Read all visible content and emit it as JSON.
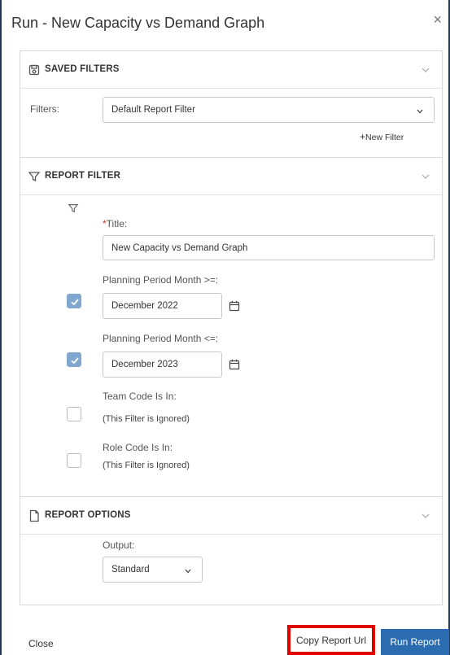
{
  "modal": {
    "title": "Run - New Capacity vs Demand Graph",
    "close_glyph": "×"
  },
  "saved_filters": {
    "heading": "SAVED FILTERS",
    "filters_label": "Filters:",
    "selected_filter": "Default Report Filter",
    "new_filter_label": "New Filter"
  },
  "report_filter": {
    "heading": "REPORT FILTER",
    "title_required_mark": "*",
    "title_label": "Title:",
    "title_value": "New Capacity vs Demand Graph",
    "period_from_label": "Planning Period Month >=:",
    "period_from_value": "December 2022",
    "period_from_checked": true,
    "period_to_label": "Planning Period Month <=:",
    "period_to_value": "December 2023",
    "period_to_checked": true,
    "team_code_label": "Team Code Is In:",
    "team_code_note": "(This Filter is Ignored)",
    "role_code_label": "Role Code Is In:",
    "role_code_note": "(This Filter is Ignored)"
  },
  "report_options": {
    "heading": "REPORT OPTIONS",
    "output_label": "Output:",
    "output_value": "Standard"
  },
  "footer": {
    "close_label": "Close",
    "copy_url_label": "Copy Report Url",
    "run_label": "Run Report"
  },
  "colors": {
    "primary_button": "#2b6cb0",
    "highlight_border": "#e00000",
    "checkbox_checked": "#7fa7d0"
  }
}
